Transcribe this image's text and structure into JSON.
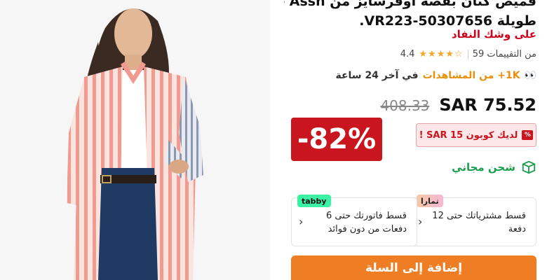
{
  "product": {
    "title_line1": "قميص كتان بقصة أوفرسايز من Polo Assn طويلة",
    "title_line2": "طويلة VR223-50307656.",
    "stock_status": "على وشك النفاد",
    "rating": "4.4",
    "ratings_count": "59 من التقييمات",
    "stars": "★★★★☆",
    "views_count": "1K+ من المشاهدات",
    "views_suffix": "في آخر 24 ساعة",
    "old_price": "408.33",
    "new_price": "SAR 75.52",
    "discount": "-82%",
    "coupon": "لديك كوبون SAR 15 !",
    "shipping": "شحن مجاني"
  },
  "installments": {
    "tamara": {
      "brand": "تمارا",
      "text": "قسط مشترياتك حتى 12 دفعة"
    },
    "tabby": {
      "brand": "tabby",
      "text": "قسط فاتورتك حتى 6 دفعات من دون فوائد"
    }
  },
  "cart": {
    "label": "إضافة إلى السلة"
  },
  "colors": {
    "accent": "#ee7d24",
    "discount": "#c8151e",
    "stock": "#d0021b",
    "shipping": "#1a9e4e",
    "tabby": "#3bf2a4"
  },
  "icons": {
    "eyes": "eyes-icon",
    "coupon": "coupon-icon",
    "shipping": "box-icon",
    "chevron": "chevron-left-icon"
  }
}
